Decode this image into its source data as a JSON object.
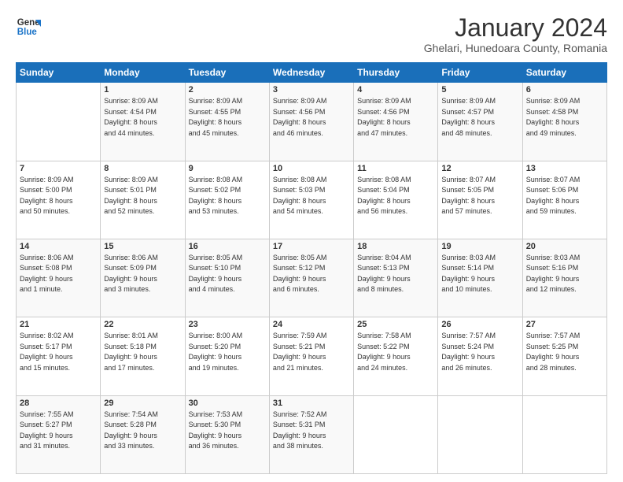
{
  "logo": {
    "line1": "General",
    "line2": "Blue"
  },
  "title": "January 2024",
  "subtitle": "Ghelari, Hunedoara County, Romania",
  "days_header": [
    "Sunday",
    "Monday",
    "Tuesday",
    "Wednesday",
    "Thursday",
    "Friday",
    "Saturday"
  ],
  "weeks": [
    [
      {
        "num": "",
        "info": ""
      },
      {
        "num": "1",
        "info": "Sunrise: 8:09 AM\nSunset: 4:54 PM\nDaylight: 8 hours\nand 44 minutes."
      },
      {
        "num": "2",
        "info": "Sunrise: 8:09 AM\nSunset: 4:55 PM\nDaylight: 8 hours\nand 45 minutes."
      },
      {
        "num": "3",
        "info": "Sunrise: 8:09 AM\nSunset: 4:56 PM\nDaylight: 8 hours\nand 46 minutes."
      },
      {
        "num": "4",
        "info": "Sunrise: 8:09 AM\nSunset: 4:56 PM\nDaylight: 8 hours\nand 47 minutes."
      },
      {
        "num": "5",
        "info": "Sunrise: 8:09 AM\nSunset: 4:57 PM\nDaylight: 8 hours\nand 48 minutes."
      },
      {
        "num": "6",
        "info": "Sunrise: 8:09 AM\nSunset: 4:58 PM\nDaylight: 8 hours\nand 49 minutes."
      }
    ],
    [
      {
        "num": "7",
        "info": "Sunrise: 8:09 AM\nSunset: 5:00 PM\nDaylight: 8 hours\nand 50 minutes."
      },
      {
        "num": "8",
        "info": "Sunrise: 8:09 AM\nSunset: 5:01 PM\nDaylight: 8 hours\nand 52 minutes."
      },
      {
        "num": "9",
        "info": "Sunrise: 8:08 AM\nSunset: 5:02 PM\nDaylight: 8 hours\nand 53 minutes."
      },
      {
        "num": "10",
        "info": "Sunrise: 8:08 AM\nSunset: 5:03 PM\nDaylight: 8 hours\nand 54 minutes."
      },
      {
        "num": "11",
        "info": "Sunrise: 8:08 AM\nSunset: 5:04 PM\nDaylight: 8 hours\nand 56 minutes."
      },
      {
        "num": "12",
        "info": "Sunrise: 8:07 AM\nSunset: 5:05 PM\nDaylight: 8 hours\nand 57 minutes."
      },
      {
        "num": "13",
        "info": "Sunrise: 8:07 AM\nSunset: 5:06 PM\nDaylight: 8 hours\nand 59 minutes."
      }
    ],
    [
      {
        "num": "14",
        "info": "Sunrise: 8:06 AM\nSunset: 5:08 PM\nDaylight: 9 hours\nand 1 minute."
      },
      {
        "num": "15",
        "info": "Sunrise: 8:06 AM\nSunset: 5:09 PM\nDaylight: 9 hours\nand 3 minutes."
      },
      {
        "num": "16",
        "info": "Sunrise: 8:05 AM\nSunset: 5:10 PM\nDaylight: 9 hours\nand 4 minutes."
      },
      {
        "num": "17",
        "info": "Sunrise: 8:05 AM\nSunset: 5:12 PM\nDaylight: 9 hours\nand 6 minutes."
      },
      {
        "num": "18",
        "info": "Sunrise: 8:04 AM\nSunset: 5:13 PM\nDaylight: 9 hours\nand 8 minutes."
      },
      {
        "num": "19",
        "info": "Sunrise: 8:03 AM\nSunset: 5:14 PM\nDaylight: 9 hours\nand 10 minutes."
      },
      {
        "num": "20",
        "info": "Sunrise: 8:03 AM\nSunset: 5:16 PM\nDaylight: 9 hours\nand 12 minutes."
      }
    ],
    [
      {
        "num": "21",
        "info": "Sunrise: 8:02 AM\nSunset: 5:17 PM\nDaylight: 9 hours\nand 15 minutes."
      },
      {
        "num": "22",
        "info": "Sunrise: 8:01 AM\nSunset: 5:18 PM\nDaylight: 9 hours\nand 17 minutes."
      },
      {
        "num": "23",
        "info": "Sunrise: 8:00 AM\nSunset: 5:20 PM\nDaylight: 9 hours\nand 19 minutes."
      },
      {
        "num": "24",
        "info": "Sunrise: 7:59 AM\nSunset: 5:21 PM\nDaylight: 9 hours\nand 21 minutes."
      },
      {
        "num": "25",
        "info": "Sunrise: 7:58 AM\nSunset: 5:22 PM\nDaylight: 9 hours\nand 24 minutes."
      },
      {
        "num": "26",
        "info": "Sunrise: 7:57 AM\nSunset: 5:24 PM\nDaylight: 9 hours\nand 26 minutes."
      },
      {
        "num": "27",
        "info": "Sunrise: 7:57 AM\nSunset: 5:25 PM\nDaylight: 9 hours\nand 28 minutes."
      }
    ],
    [
      {
        "num": "28",
        "info": "Sunrise: 7:55 AM\nSunset: 5:27 PM\nDaylight: 9 hours\nand 31 minutes."
      },
      {
        "num": "29",
        "info": "Sunrise: 7:54 AM\nSunset: 5:28 PM\nDaylight: 9 hours\nand 33 minutes."
      },
      {
        "num": "30",
        "info": "Sunrise: 7:53 AM\nSunset: 5:30 PM\nDaylight: 9 hours\nand 36 minutes."
      },
      {
        "num": "31",
        "info": "Sunrise: 7:52 AM\nSunset: 5:31 PM\nDaylight: 9 hours\nand 38 minutes."
      },
      {
        "num": "",
        "info": ""
      },
      {
        "num": "",
        "info": ""
      },
      {
        "num": "",
        "info": ""
      }
    ]
  ]
}
